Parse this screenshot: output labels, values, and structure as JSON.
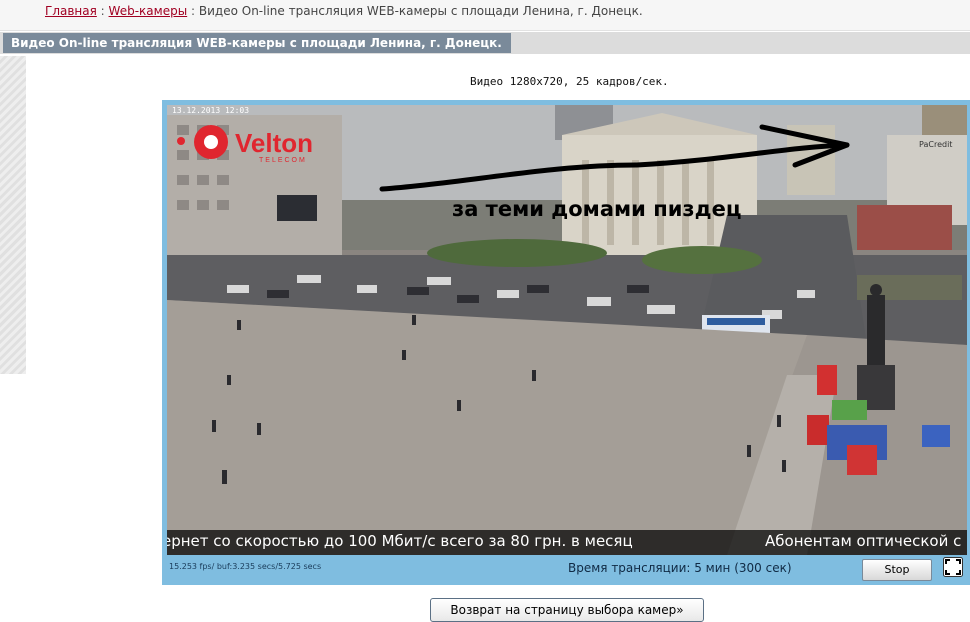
{
  "breadcrumb": {
    "home": "Главная",
    "sep1": ":",
    "cameras": "Web-камеры",
    "sep2": ":",
    "current": "Видео On-line трансляция WEB-камеры с площади Ленина, г. Донецк."
  },
  "page_title": "Видео On-line трансляция WEB-камеры с площади Ленина, г. Донецк.",
  "video_caption": "Видео 1280х720, 25 кадров/сек.",
  "video": {
    "timestamp": "13.12.2013 12:03",
    "logo_text": "Velton",
    "logo_subtext": "TELECOM",
    "overlay_text": "за теми домами пиздец",
    "building_sign": "PaCredit",
    "ticker_left": "ернет со скоростью до 100 Мбит/с всего за 80 грн. в месяц",
    "ticker_right": "Абонентам оптической с",
    "logo_color": "#e0262f"
  },
  "status": {
    "fps": "15.253 fps/ buf:3.235 secs/5.725 secs",
    "duration": "Время трансляции: 5 мин (300 сек)"
  },
  "controls": {
    "stop_label": "Stop",
    "fullscreen_icon": "fullscreen-icon",
    "back_label": "Возврат на страницу выбора камер»"
  }
}
